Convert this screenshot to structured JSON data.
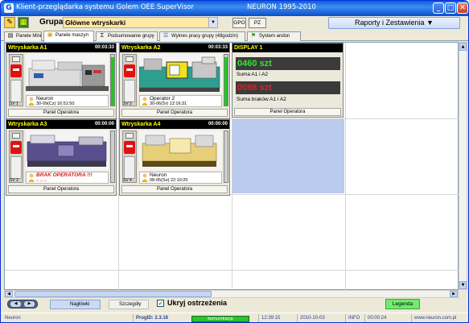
{
  "window": {
    "title": "Klient-przeglądarka systemu Golem OEE SuperVisor",
    "title_right": "NEURON 1995-2010",
    "controls": {
      "minimize": "_",
      "maximize": "□",
      "close": "✕"
    }
  },
  "toolbar": {
    "grupa_label": "Grupa",
    "grupa_value": "Główne wtryskarki",
    "gpo_label": "GPO",
    "pz_label": "PZ",
    "raport_label": "Raporty i Zestawienia ▼"
  },
  "tabs": [
    {
      "label": "Panele Mini",
      "icon": "mini-panel-icon"
    },
    {
      "label": "Panele maszyn",
      "icon": "machine-panel-icon",
      "active": true
    },
    {
      "label": "Podsumowanie grupy",
      "icon": "sigma-icon"
    },
    {
      "label": "Wykres pracy grupy (48godzin)",
      "icon": "chart-icon"
    },
    {
      "label": "System andon",
      "icon": "flag-icon"
    }
  ],
  "machines": [
    {
      "name": "Wtryskarka A1",
      "time": "00:03:33",
      "sv": "SV 1",
      "operator": "Neuron",
      "datetime": "30-09(Cz) 16:51:50",
      "footer": "Panel Operatora",
      "level": 0.95,
      "status_color": "#e31010"
    },
    {
      "name": "Wtryskarka A2",
      "time": "00:03:33",
      "sv": "SV 2",
      "operator": "Operator 2",
      "datetime": "30-06(Śr) 12:16:31",
      "footer": "Panel Operatora",
      "level": 0.95,
      "status_color": "#e31010"
    },
    {
      "name": "Wtryskarka A3",
      "time": "00:00:00",
      "sv": "SV 3",
      "warning": "BRAK OPERATORA !!!",
      "warning_sub": "-- -- --",
      "footer": "Panel Operatora",
      "status_color": "#e31010"
    },
    {
      "name": "Wtryskarka A4",
      "time": "00:00:00",
      "sv": "SV 4",
      "operator": "Neuron",
      "datetime": "08-05(So) 22:10:20",
      "footer": "Panel Operatora",
      "status_color": "#e31010"
    }
  ],
  "display": {
    "title": "DISPLAY 1",
    "value1": "0460 szt",
    "value1_color": "#2ee82e",
    "caption1": "Suma A1 i A2",
    "value2": "0098 szt",
    "value2_color": "#e02020",
    "caption2": "Suma braków A1 i A2",
    "footer": "Panel Operatora"
  },
  "bottombar": {
    "naglowki": "Nagłówki",
    "szczegoly": "Szczegóły",
    "ukryj_checked": "✔",
    "ukryj": "Ukryj ostrzeżenia",
    "legenda": "Legenda"
  },
  "statusbar": {
    "user": "Neuron",
    "progid": "ProgID: 2.3.16",
    "komunikacja": "komunikacja",
    "time": "12:39:15",
    "date": "2010-10-03",
    "info": "INFO",
    "info_time": "00:00:24",
    "website": "www.neuron.com.pl"
  }
}
